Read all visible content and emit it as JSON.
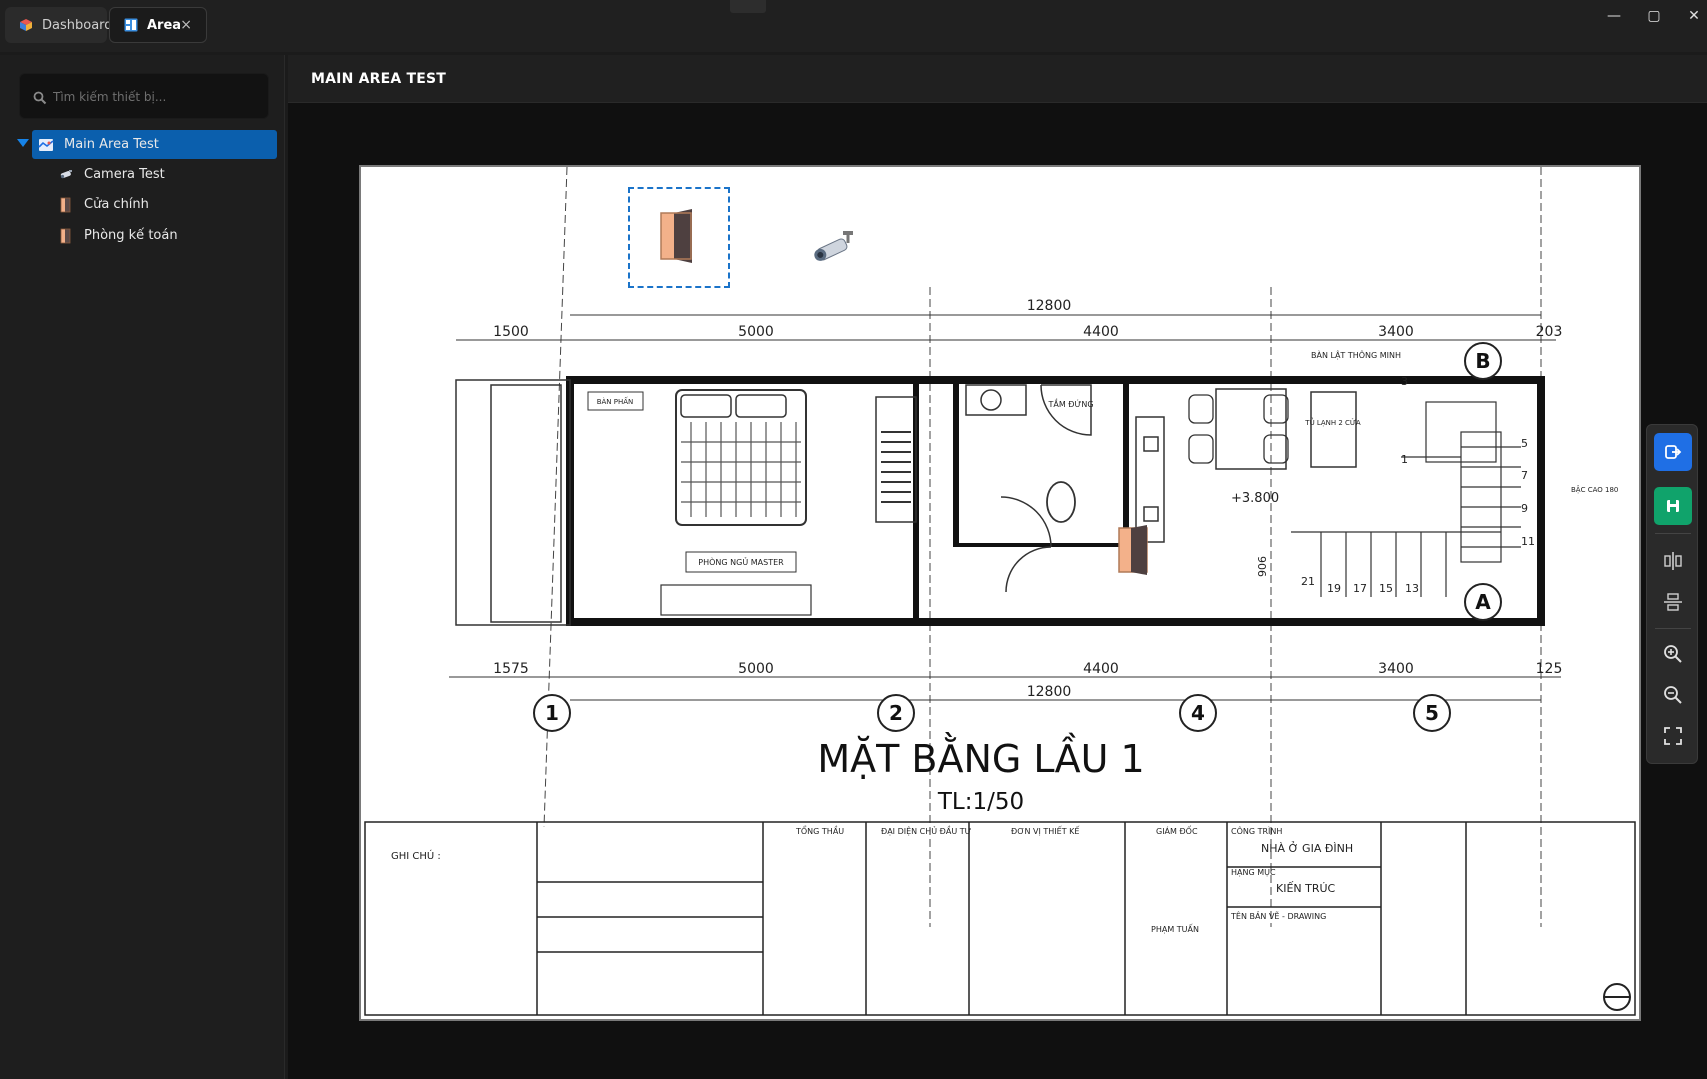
{
  "tabs": [
    {
      "label": "Dashboard",
      "icon": "cube-icon",
      "active": false
    },
    {
      "label": "Area",
      "icon": "floorplan-icon",
      "active": true,
      "close": "×"
    }
  ],
  "window": {
    "minimize": "—",
    "maximize": "▢",
    "close": "✕"
  },
  "sidebar": {
    "search_placeholder": "Tìm kiếm thiết bị...",
    "tree": {
      "root": {
        "label": "Main Area Test",
        "icon": "area-map-icon",
        "expanded": true
      },
      "children": [
        {
          "label": "Camera Test",
          "icon": "camera-icon"
        },
        {
          "label": "Cửa chính",
          "icon": "door-icon"
        },
        {
          "label": "Phòng kế toán",
          "icon": "door-icon"
        }
      ]
    }
  },
  "main": {
    "title": "MAIN AREA TEST",
    "floorplan": {
      "title": "MẶT BẰNG LẦU 1",
      "scale": "TL:1/50",
      "dim_top_total": "12800",
      "dim_top": [
        "1500",
        "5000",
        "4400",
        "3400",
        "203"
      ],
      "dim_bottom": [
        "1575",
        "5000",
        "4400",
        "3400",
        "125"
      ],
      "dim_bottom_total": "12800",
      "grid_cols": [
        "1",
        "2",
        "4",
        "5"
      ],
      "grid_rows": [
        "B",
        "A"
      ],
      "labels": {
        "ban_phan": "BÀN PHẤN",
        "phong_ngu": "PHÒNG NGỦ MASTER",
        "tam_dung": "TẮM ĐỨNG",
        "tu_lanh": "TỦ LẠNH 2 CỬA",
        "level": "+3.800",
        "ban_lat": "BÀN LẬT THÔNG MINH",
        "bac_cao": "BẬC CAO 180",
        "dim_906": "906"
      },
      "stairs": [
        "3",
        "1",
        "5",
        "7",
        "9",
        "11",
        "21",
        "19",
        "17",
        "15",
        "13"
      ],
      "titleblock": {
        "ghi_chu": "GHI CHÚ :",
        "tong_thau": "TỔNG THẦU",
        "dai_dien": "ĐẠI DIỆN CHỦ ĐẦU TƯ",
        "don_vi": "ĐƠN VỊ THIẾT KẾ",
        "giam_doc": "GIÁM ĐỐC",
        "cong_trinh_label": "CÔNG TRÌNH",
        "cong_trinh": "NHÀ Ở GIA ĐÌNH",
        "hang_muc_label": "HẠNG MỤC",
        "hang_muc": "KIẾN TRÚC",
        "ten_ban_ve": "TÊN BẢN VẼ - DRAWING",
        "ky_ten": "PHẠM TUẤN"
      }
    },
    "devices": [
      {
        "type": "door",
        "icon": "door-icon",
        "selected": true
      },
      {
        "type": "camera",
        "icon": "camera-icon",
        "selected": false
      },
      {
        "type": "door",
        "icon": "door-icon",
        "selected": false
      }
    ]
  },
  "toolbar": [
    {
      "name": "export",
      "icon": "export-icon",
      "color": "#1f6fe5"
    },
    {
      "name": "save",
      "icon": "save-icon",
      "color": "#10a36b"
    },
    {
      "name": "align-vertical",
      "icon": "align-vertical-icon"
    },
    {
      "name": "align-horizontal",
      "icon": "align-horizontal-icon"
    },
    {
      "name": "zoom-in",
      "icon": "zoom-in-icon"
    },
    {
      "name": "zoom-out",
      "icon": "zoom-out-icon"
    },
    {
      "name": "fit-screen",
      "icon": "fit-screen-icon"
    }
  ]
}
